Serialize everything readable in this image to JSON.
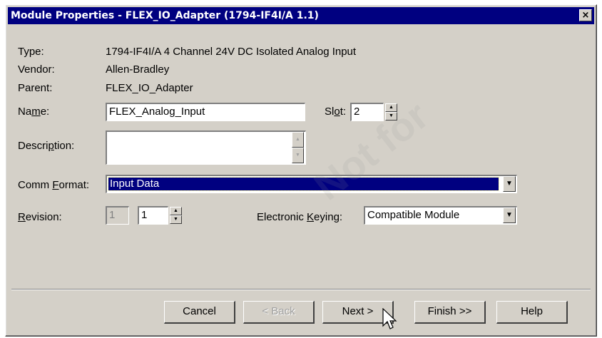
{
  "window": {
    "title": "Module Properties - FLEX_IO_Adapter (1794-IF4I/A 1.1)",
    "close_glyph": "×"
  },
  "info": {
    "type_label": "Type:",
    "type_value": "1794-IF4I/A 4 Channel 24V DC Isolated Analog Input",
    "vendor_label": "Vendor:",
    "vendor_value": "Allen-Bradley",
    "parent_label": "Parent:",
    "parent_value": "FLEX_IO_Adapter"
  },
  "name": {
    "label_pre": "Na",
    "label_ul": "m",
    "label_post": "e:",
    "value": "FLEX_Analog_Input"
  },
  "slot": {
    "label_pre": "Sl",
    "label_ul": "o",
    "label_post": "t:",
    "value": "2"
  },
  "description": {
    "label_pre": "Descri",
    "label_ul": "p",
    "label_post": "tion:",
    "value": ""
  },
  "comm_format": {
    "label_pre": "Comm ",
    "label_ul": "F",
    "label_post": "ormat:",
    "value": "Input Data"
  },
  "revision": {
    "label_pre": "",
    "label_ul": "R",
    "label_post": "evision:",
    "major": "1",
    "minor": "1"
  },
  "keying": {
    "label_pre": "Electronic ",
    "label_ul": "K",
    "label_post": "eying:",
    "value": "Compatible Module"
  },
  "buttons": {
    "cancel": "Cancel",
    "back": "< Back",
    "next": "Next >",
    "finish": "Finish >>",
    "help": "Help"
  },
  "icons": {
    "spin_up": "▲",
    "spin_down": "▼",
    "dropdown": "▼"
  },
  "watermark": "Not for"
}
